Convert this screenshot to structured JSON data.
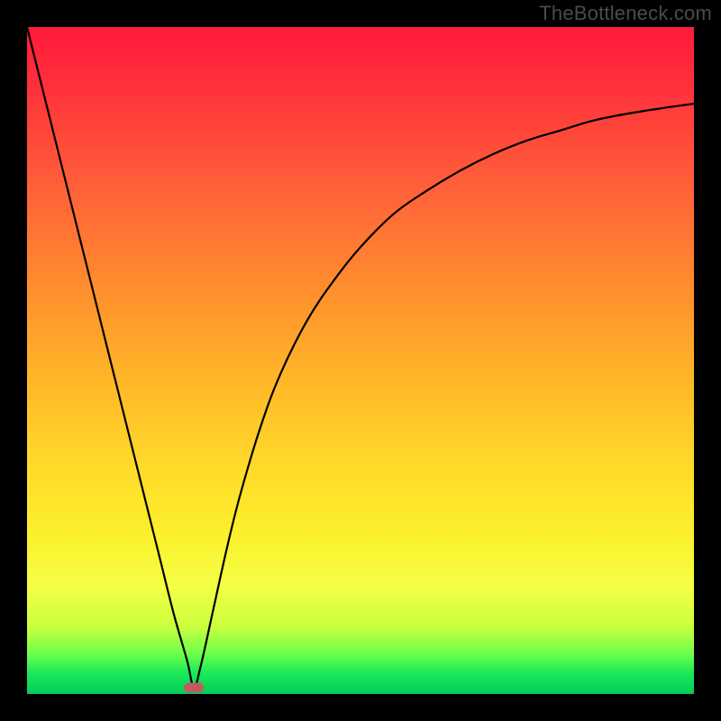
{
  "watermark": "TheBottleneck.com",
  "chart_data": {
    "type": "line",
    "title": "",
    "xlabel": "",
    "ylabel": "",
    "xlim": [
      0,
      100
    ],
    "ylim": [
      0,
      100
    ],
    "grid": false,
    "legend": false,
    "series": [
      {
        "name": "bottleneck-curve",
        "x": [
          0,
          2,
          4,
          6,
          8,
          10,
          12,
          14,
          16,
          18,
          20,
          22,
          24,
          25,
          26,
          28,
          30,
          32,
          35,
          38,
          42,
          46,
          50,
          55,
          60,
          65,
          70,
          75,
          80,
          85,
          90,
          95,
          100
        ],
        "values": [
          100,
          92,
          84,
          76,
          68,
          60,
          52,
          44,
          36,
          28,
          20,
          12,
          5,
          1,
          4,
          13,
          22,
          30,
          40,
          48,
          56,
          62,
          67,
          72,
          75.5,
          78.5,
          81,
          83,
          84.5,
          86,
          87,
          87.8,
          88.5
        ]
      }
    ],
    "minimum_point": {
      "x": 25,
      "y": 1
    },
    "gradient_stops": [
      {
        "pos": 0,
        "color": "#ff1a3a"
      },
      {
        "pos": 22,
        "color": "#ff5a3a"
      },
      {
        "pos": 52,
        "color": "#ffb428"
      },
      {
        "pos": 76,
        "color": "#fcf02c"
      },
      {
        "pos": 94,
        "color": "#6bff4a"
      },
      {
        "pos": 100,
        "color": "#08c95c"
      }
    ],
    "marker_color": "#c15a5e"
  }
}
